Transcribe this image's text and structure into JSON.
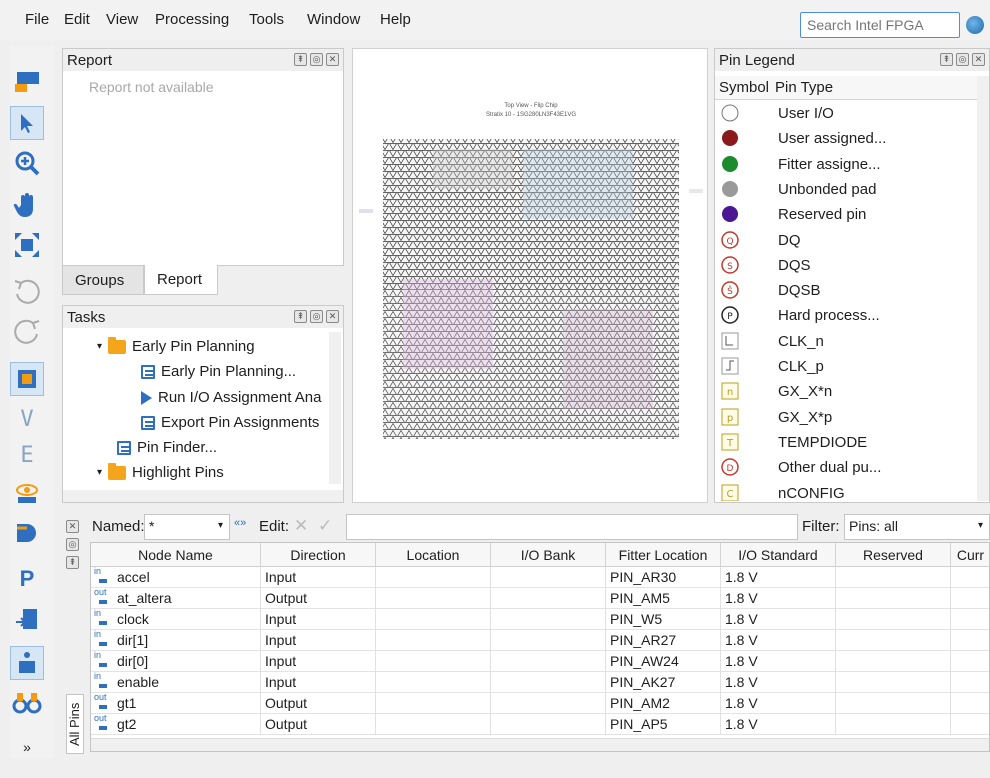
{
  "menu": [
    "File",
    "Edit",
    "View",
    "Processing",
    "Tools",
    "Window",
    "Help"
  ],
  "search": {
    "placeholder": "Search Intel FPGA"
  },
  "toolbar": {
    "icons": [
      "compile-icon",
      "select-arrow-icon",
      "zoom-in-icon",
      "hand-pan-icon",
      "fit-view-icon",
      "undo-icon",
      "redo-icon",
      "chip-view-icon",
      "io-bank-icon",
      "package-icon",
      "eye-icon",
      "pin-icon",
      "pin-assignment-icon",
      "export-icon",
      "info-icon",
      "binoculars-icon",
      "more-icon"
    ]
  },
  "report_panel": {
    "title": "Report",
    "empty_text": "Report not available"
  },
  "tabs": {
    "groups": "Groups",
    "report": "Report"
  },
  "tasks_panel": {
    "title": "Tasks",
    "items": [
      {
        "label": "Early Pin Planning",
        "kind": "folder"
      },
      {
        "label": "Early Pin Planning...",
        "kind": "doc"
      },
      {
        "label": "Run I/O Assignment Ana",
        "kind": "run"
      },
      {
        "label": "Export Pin Assignments",
        "kind": "doc"
      },
      {
        "label": "Pin Finder...",
        "kind": "doc"
      },
      {
        "label": "Highlight Pins",
        "kind": "folder"
      }
    ]
  },
  "chip_view": {
    "title_line1": "Top View - Flip Chip",
    "title_line2": "Stratix 10 - 1SG280LN3F43E1VG"
  },
  "legend": {
    "title": "Pin Legend",
    "col_symbol": "Symbol",
    "col_type": "Pin Type",
    "items": [
      {
        "label": "User I/O",
        "symbol": "white-circle",
        "color": "#ffffff"
      },
      {
        "label": "User assigned...",
        "symbol": "filled-circle",
        "color": "#8b1a1a"
      },
      {
        "label": "Fitter assigne...",
        "symbol": "filled-circle",
        "color": "#1e8a2e"
      },
      {
        "label": "Unbonded pad",
        "symbol": "filled-circle",
        "color": "#9a9a9a"
      },
      {
        "label": "Reserved pin",
        "symbol": "filled-circle",
        "color": "#4b1694"
      },
      {
        "label": "DQ",
        "symbol": "Q",
        "color": "#c0392b"
      },
      {
        "label": "DQS",
        "symbol": "S",
        "color": "#c0392b"
      },
      {
        "label": "DQSB",
        "symbol": "Š",
        "color": "#c0392b"
      },
      {
        "label": "Hard process...",
        "symbol": "P",
        "color": "#222222"
      },
      {
        "label": "CLK_n",
        "symbol": "clk-n",
        "color": "#888888"
      },
      {
        "label": "CLK_p",
        "symbol": "clk-p",
        "color": "#888888"
      },
      {
        "label": "GX_X*n",
        "symbol": "n",
        "color": "#b8a020"
      },
      {
        "label": "GX_X*p",
        "symbol": "p",
        "color": "#b8a020"
      },
      {
        "label": "TEMPDIODE",
        "symbol": "T",
        "color": "#b8a020"
      },
      {
        "label": "Other dual pu...",
        "symbol": "D",
        "color": "#c0392b"
      },
      {
        "label": "nCONFIG",
        "symbol": "C",
        "color": "#b8a020"
      }
    ]
  },
  "filter_bar": {
    "named_label": "Named:",
    "named_value": "*",
    "edit_label": "Edit:",
    "filter_label": "Filter:",
    "filter_value": "Pins: all"
  },
  "side_tab": "All Pins",
  "table": {
    "columns": [
      "Node Name",
      "Direction",
      "Location",
      "I/O Bank",
      "Fitter Location",
      "I/O Standard",
      "Reserved",
      "Curr"
    ],
    "rows": [
      {
        "dir_badge": "in",
        "name": "accel",
        "direction": "Input",
        "location": "",
        "bank": "",
        "fitter": "PIN_AR30",
        "std": "1.8 V",
        "reserved": ""
      },
      {
        "dir_badge": "out",
        "name": "at_altera",
        "direction": "Output",
        "location": "",
        "bank": "",
        "fitter": "PIN_AM5",
        "std": "1.8 V",
        "reserved": ""
      },
      {
        "dir_badge": "in",
        "name": "clock",
        "direction": "Input",
        "location": "",
        "bank": "",
        "fitter": "PIN_W5",
        "std": "1.8 V",
        "reserved": ""
      },
      {
        "dir_badge": "in",
        "name": "dir[1]",
        "direction": "Input",
        "location": "",
        "bank": "",
        "fitter": "PIN_AR27",
        "std": "1.8 V",
        "reserved": ""
      },
      {
        "dir_badge": "in",
        "name": "dir[0]",
        "direction": "Input",
        "location": "",
        "bank": "",
        "fitter": "PIN_AW24",
        "std": "1.8 V",
        "reserved": ""
      },
      {
        "dir_badge": "in",
        "name": "enable",
        "direction": "Input",
        "location": "",
        "bank": "",
        "fitter": "PIN_AK27",
        "std": "1.8 V",
        "reserved": ""
      },
      {
        "dir_badge": "out",
        "name": "gt1",
        "direction": "Output",
        "location": "",
        "bank": "",
        "fitter": "PIN_AM2",
        "std": "1.8 V",
        "reserved": ""
      },
      {
        "dir_badge": "out",
        "name": "gt2",
        "direction": "Output",
        "location": "",
        "bank": "",
        "fitter": "PIN_AP5",
        "std": "1.8 V",
        "reserved": ""
      }
    ]
  }
}
